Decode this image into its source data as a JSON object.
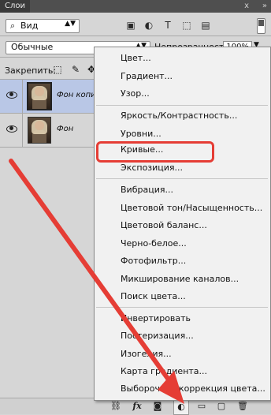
{
  "panel": {
    "tab_title": "Слои",
    "close_glyph": "x",
    "collapse_glyph": "»"
  },
  "filter": {
    "kind_label": "Вид",
    "kind_icon": "search-icon"
  },
  "blend": {
    "mode_label": "Обычные",
    "opacity_label": "Непрозрачность:",
    "opacity_value": "100%"
  },
  "lock": {
    "label": "Закрепить:"
  },
  "layers": [
    {
      "name": "Фон копия",
      "visible": true,
      "selected": true
    },
    {
      "name": "Фон",
      "visible": true,
      "selected": false
    }
  ],
  "menu": {
    "items": [
      "Цвет...",
      "Градиент...",
      "Узор...",
      "Яркость/Контрастность...",
      "Уровни...",
      "Кривые...",
      "Экспозиция...",
      "Вибрация...",
      "Цветовой тон/Насыщенность...",
      "Цветовой баланс...",
      "Черно-белое...",
      "Фотофильтр...",
      "Микширование каналов...",
      "Поиск цвета...",
      "Инвертировать",
      "Постеризация...",
      "Изогелия...",
      "Карта градиента...",
      "Выборочная коррекция цвета..."
    ],
    "highlighted_item": "Кривые..."
  },
  "toolbar": {
    "link_icon": "link-icon",
    "fx_label": "fx",
    "mask_icon": "mask-icon",
    "adjustment_icon": "adjustment-layer-icon",
    "group_icon": "folder-icon",
    "new_layer_icon": "new-layer-icon",
    "trash_icon": "trash-icon"
  },
  "colors": {
    "annotation_red": "#e53d35",
    "selection_blue": "#b9c7e6",
    "panel_gray": "#d6d6d6"
  }
}
